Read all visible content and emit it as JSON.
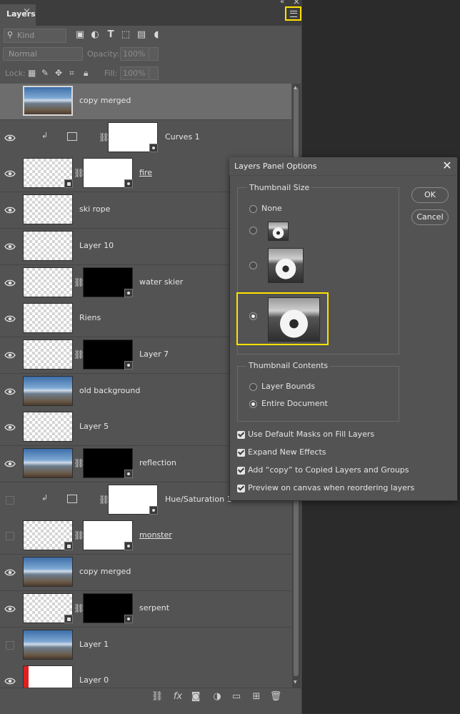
{
  "panel": {
    "tab_label": "Layers",
    "tab_close": "×",
    "collapse_glyph": "«",
    "close_glyph": "×"
  },
  "filter": {
    "kind_label": "Kind",
    "blend_mode": "Normal",
    "opacity_label": "Opacity:",
    "opacity_value": "100%",
    "lock_label": "Lock:",
    "fill_label": "Fill:",
    "fill_value": "100%"
  },
  "layers": [
    {
      "name": "copy merged",
      "visible": false,
      "selected": true
    },
    {
      "name": "Curves 1",
      "visible": true,
      "type": "adjustment"
    },
    {
      "name": "fire",
      "visible": true,
      "underline": true
    },
    {
      "name": "ski rope",
      "visible": true
    },
    {
      "name": "Layer 10",
      "visible": true
    },
    {
      "name": "water skier",
      "visible": true
    },
    {
      "name": "Riens",
      "visible": true
    },
    {
      "name": "Layer 7",
      "visible": true
    },
    {
      "name": "old background",
      "visible": true
    },
    {
      "name": "Layer 5",
      "visible": true
    },
    {
      "name": "reflection",
      "visible": true
    },
    {
      "name": "Hue/Saturation 1",
      "visible": false,
      "type": "adjustment"
    },
    {
      "name": "monster",
      "visible": false,
      "underline": true
    },
    {
      "name": "copy merged",
      "visible": true
    },
    {
      "name": "serpent",
      "visible": true
    },
    {
      "name": "Layer 1",
      "visible": false
    },
    {
      "name": "Layer 0",
      "visible": true
    }
  ],
  "dialog": {
    "title": "Layers Panel Options",
    "close_glyph": "✕",
    "thumbnail_size": {
      "label": "Thumbnail Size",
      "options": [
        "None",
        "Small",
        "Medium",
        "Large"
      ],
      "none_label": "None",
      "selected": "Large"
    },
    "thumbnail_contents": {
      "label": "Thumbnail Contents",
      "layer_bounds": "Layer Bounds",
      "entire_document": "Entire Document",
      "selected": "Entire Document"
    },
    "checkboxes": [
      {
        "label": "Use Default Masks on Fill Layers",
        "checked": true
      },
      {
        "label": "Expand New Effects",
        "checked": true
      },
      {
        "label": "Add “copy” to Copied Layers and Groups",
        "checked": true
      },
      {
        "label": "Preview on canvas when reordering layers",
        "checked": true
      }
    ],
    "ok_label": "OK",
    "cancel_label": "Cancel"
  },
  "colors": {
    "highlight": "#ffe200",
    "panel_bg": "#535353",
    "selected_row": "#6d6d6d"
  }
}
